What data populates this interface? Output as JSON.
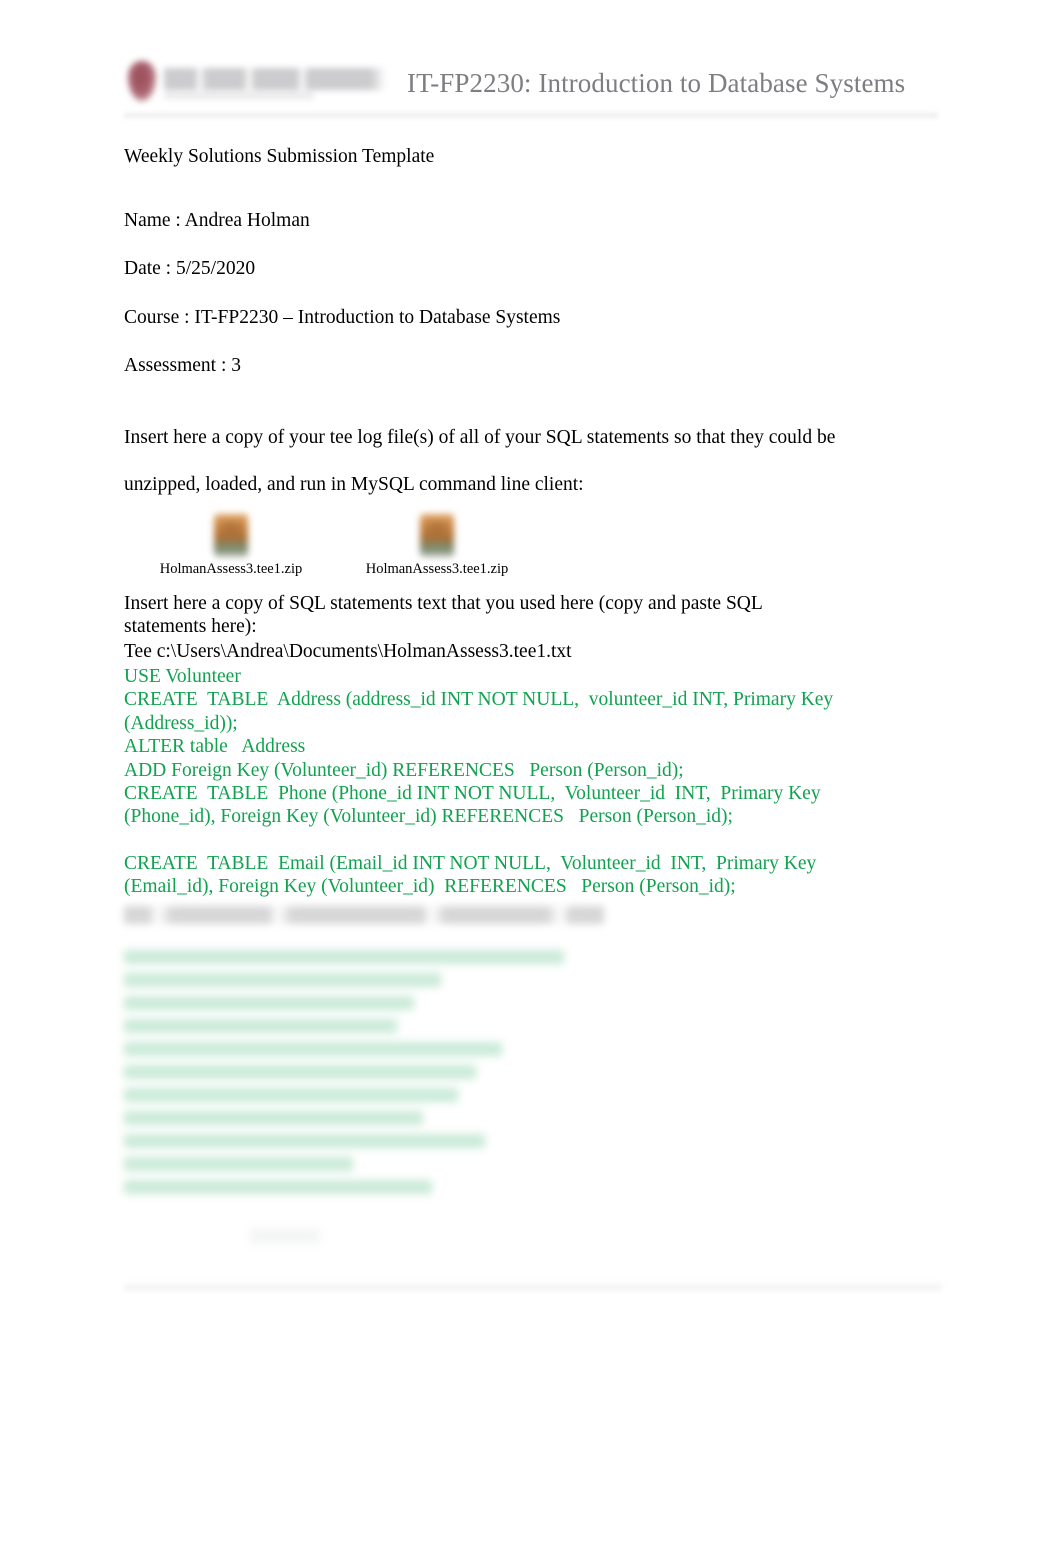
{
  "header": {
    "logo_alt": "capella-university-logo",
    "course_title": "IT-FP2230: Introduction to Database Systems"
  },
  "document": {
    "template_title": "Weekly Solutions Submission Template",
    "meta": {
      "name": "Name :  Andrea Holman",
      "date": "Date :  5/25/2020",
      "course": "Course : IT-FP2230 – Introduction to Database Systems",
      "assessment": "Assessment : 3"
    },
    "instructions": {
      "line1": "Insert here a copy of your tee log file(s) of all of your SQL statements so that they could be",
      "line2": "unzipped, loaded, and run in MySQL command line client:"
    },
    "attachments": [
      {
        "label": "HolmanAssess3.tee1.zip",
        "icon": "zip-file-icon"
      },
      {
        "label": "HolmanAssess3.tee1.zip",
        "icon": "zip-file-icon"
      }
    ],
    "sql_section": {
      "prompt": "Insert here a copy of SQL statements text that you used here (copy and paste SQL statements here):",
      "tee_path": "Tee c:\\Users\\Andrea\\Documents\\HolmanAssess3.tee1.txt",
      "code_lines": [
        "USE Volunteer",
        "CREATE  TABLE  Address (address_id INT NOT NULL,  volunteer_id INT, Primary Key",
        "(Address_id));",
        "ALTER table   Address",
        "ADD Foreign Key (Volunteer_id) REFERENCES   Person (Person_id);",
        "CREATE  TABLE  Phone (Phone_id INT NOT NULL,  Volunteer_id  INT,  Primary Key",
        "(Phone_id), Foreign Key (Volunteer_id) REFERENCES   Person (Person_id);",
        "",
        "CREATE  TABLE  Email (Email_id INT NOT NULL,  Volunteer_id  INT,  Primary Key",
        "(Email_id), Foreign Key (Volunteer_id)  REFERENCES   Person (Person_id);"
      ],
      "obscured_note": "Remaining lines below are blurred and illegible in the source image.",
      "obscured_line_count": 11
    }
  },
  "colors": {
    "sql_green": "#10a24f",
    "header_title_gray": "#7d7d82",
    "logo_maroon": "#8e3444",
    "body_black": "#000000",
    "page_background": "#ffffff"
  }
}
